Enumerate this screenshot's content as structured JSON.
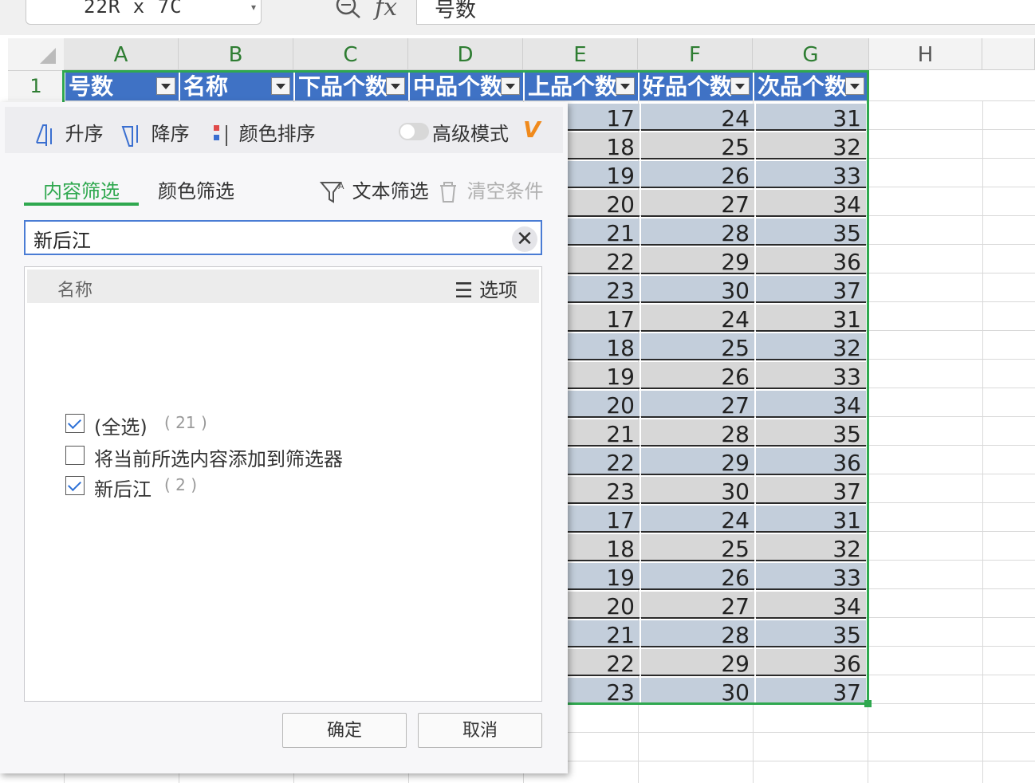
{
  "formula_bar": {
    "name_box": "22R  x  7C",
    "fx_label": "fx",
    "formula_value": "号数"
  },
  "sheet": {
    "columns": [
      "A",
      "B",
      "C",
      "D",
      "E",
      "F",
      "G",
      "H"
    ],
    "first_row_number": "1",
    "header_row": [
      "号数",
      "名称",
      "下品个数",
      "中品个数",
      "上品个数",
      "好品个数",
      "次品个数"
    ],
    "col_e": [
      "17",
      "18",
      "19",
      "20",
      "21",
      "22",
      "23",
      "17",
      "18",
      "19",
      "20",
      "21",
      "22",
      "23",
      "17",
      "18",
      "19",
      "20",
      "21",
      "22",
      "23"
    ],
    "col_f": [
      "24",
      "25",
      "26",
      "27",
      "28",
      "29",
      "30",
      "24",
      "25",
      "26",
      "27",
      "28",
      "29",
      "30",
      "24",
      "25",
      "26",
      "27",
      "28",
      "29",
      "30"
    ],
    "col_g": [
      "31",
      "32",
      "33",
      "34",
      "35",
      "36",
      "37",
      "31",
      "32",
      "33",
      "34",
      "35",
      "36",
      "37",
      "31",
      "32",
      "33",
      "34",
      "35",
      "36",
      "37"
    ]
  },
  "filter_panel": {
    "sort_asc": "升序",
    "sort_desc": "降序",
    "color_sort": "颜色排序",
    "advanced_mode": "高级模式",
    "tab_content": "内容筛选",
    "tab_color": "颜色筛选",
    "text_filter": "文本筛选",
    "clear_conditions": "清空条件",
    "search_value": "新后江",
    "list_header": "名称",
    "options_label": "选项",
    "items": [
      {
        "label": "(全选)",
        "count": "( 21 )",
        "checked": true
      },
      {
        "label": "将当前所选内容添加到筛选器",
        "count": "",
        "checked": false
      },
      {
        "label": "新后江",
        "count": "( 2 )",
        "checked": true
      }
    ],
    "ok_button": "确定",
    "cancel_button": "取消"
  },
  "colors": {
    "header_blue": "#3f72c5",
    "selection_green": "#2fa84f",
    "band_blue": "#c3cedb",
    "band_gray": "#d7d7d7"
  }
}
